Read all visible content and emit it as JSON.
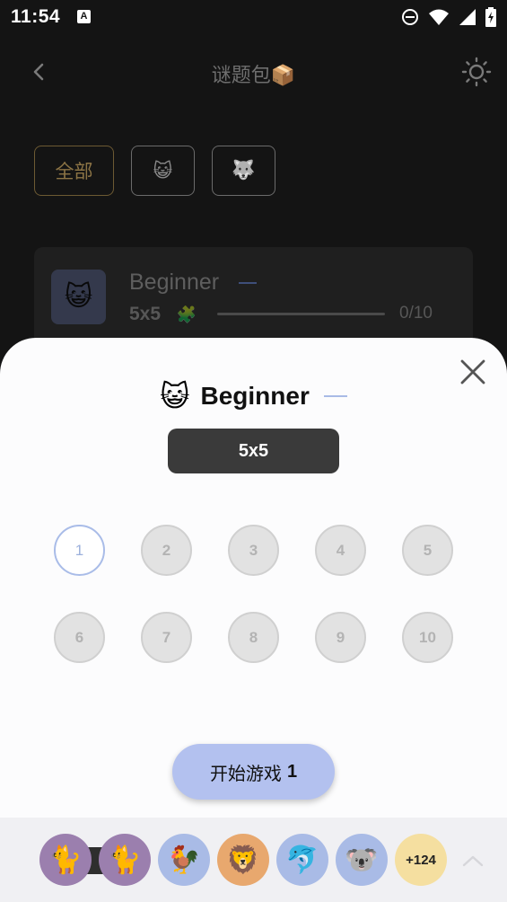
{
  "status": {
    "time": "11:54",
    "badge": "A"
  },
  "header": {
    "title": "谜题包",
    "title_emoji": "📦"
  },
  "filters": [
    {
      "label": "全部",
      "active": true
    },
    {
      "label": "😺",
      "active": false
    },
    {
      "label": "🐺",
      "active": false
    }
  ],
  "pack_card": {
    "emoji": "😺",
    "name": "Beginner",
    "size": "5x5",
    "size_icon": "🧩",
    "progress": "0/10",
    "progress_value": 0
  },
  "sheet": {
    "emoji": "😺",
    "title": "Beginner",
    "size": "5x5",
    "levels": [
      "1",
      "2",
      "3",
      "4",
      "5",
      "6",
      "7",
      "8",
      "9",
      "10"
    ],
    "selected_level": "1",
    "start_label": "开始游戏",
    "start_number": "1"
  },
  "bottom_bar": {
    "avatars": [
      {
        "emoji": "🐈",
        "bg": "#9b7fae"
      },
      {
        "emoji": "🐈",
        "bg": "#9b7fae"
      },
      {
        "emoji": "🐓",
        "bg": "#a9bbe6"
      },
      {
        "emoji": "🦁",
        "bg": "#e8a86e"
      },
      {
        "emoji": "🐬",
        "bg": "#a9bbe6"
      },
      {
        "emoji": "🐨",
        "bg": "#a9bbe6"
      }
    ],
    "more_count": "+124",
    "more_bg": "#f5dfa0"
  },
  "colors": {
    "accent": "#b3c1ef",
    "gold": "#8c7445",
    "sheet_bg": "#fcfcfd"
  }
}
